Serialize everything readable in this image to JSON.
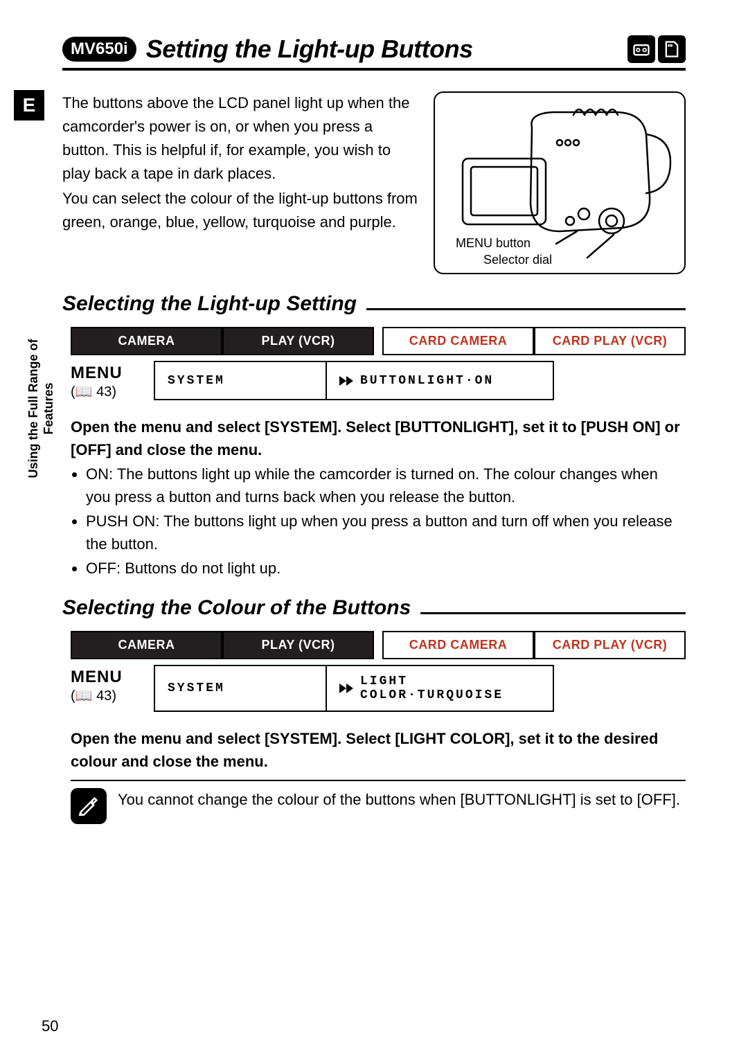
{
  "model_badge": "MV650i",
  "page_title": "Setting the Light-up Buttons",
  "section_letter": "E",
  "intro_p1": "The buttons above the LCD panel light up when the camcorder's power is on, or when you press a button. This is helpful if, for example, you wish to play back a tape in dark places.",
  "intro_p2": "You can select the colour of the light-up buttons from green, orange, blue, yellow, turquoise and purple.",
  "illus_label1": "MENU button",
  "illus_label2": "Selector dial",
  "side_label": "Using the Full Range of Features",
  "page_number": "50",
  "sec1": {
    "heading": "Selecting the Light-up Setting",
    "modes": [
      "CAMERA",
      "PLAY (VCR)",
      "CARD CAMERA",
      "CARD PLAY (VCR)"
    ],
    "menu_word": "MENU",
    "menu_ref": "43",
    "path1": "SYSTEM",
    "path2": "BUTTONLIGHT·ON",
    "instr": "Open the menu and select [SYSTEM]. Select [BUTTONLIGHT], set it to [PUSH ON] or [OFF] and close the menu.",
    "opt_on": "ON: The buttons light up while the camcorder is turned on. The colour changes when you press a button and turns back when you release the button.",
    "opt_push": "PUSH ON: The buttons light up when you press a button and turn off when you release the button.",
    "opt_off": "OFF: Buttons do not light up."
  },
  "sec2": {
    "heading": "Selecting the Colour of the Buttons",
    "modes": [
      "CAMERA",
      "PLAY (VCR)",
      "CARD CAMERA",
      "CARD PLAY (VCR)"
    ],
    "menu_word": "MENU",
    "menu_ref": "43",
    "path1": "SYSTEM",
    "path2": "LIGHT COLOR·TURQUOISE",
    "instr": "Open the menu and select [SYSTEM]. Select [LIGHT COLOR], set it to the desired colour and close the menu.",
    "note": "You cannot change the colour of the buttons when [BUTTONLIGHT] is set to [OFF]."
  }
}
